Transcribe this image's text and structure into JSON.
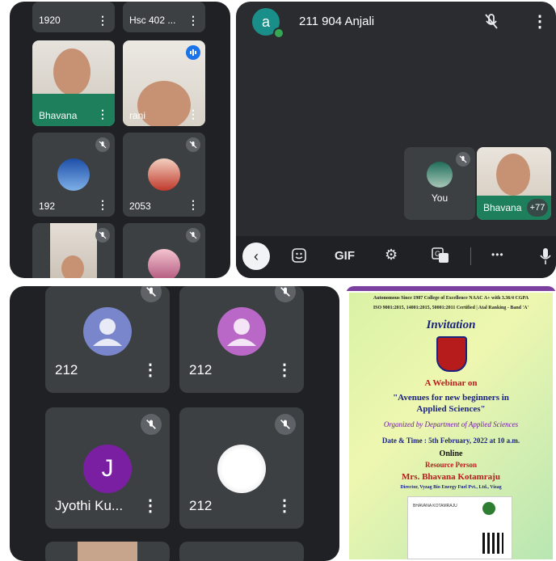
{
  "panel1": {
    "tiles": [
      {
        "name": "1920"
      },
      {
        "name": "Hsc 402 ..."
      },
      {
        "name": "Bhavana"
      },
      {
        "name": "rani"
      },
      {
        "name": "192"
      },
      {
        "name": "2053"
      }
    ]
  },
  "panel2": {
    "avatar_letter": "a",
    "title": "211 904 Anjali",
    "self_label": "You",
    "speaker_label": "Bhavana",
    "more_count": "+77",
    "toolbar": {
      "gif_label": "GIF",
      "more_label": "•••"
    }
  },
  "panel3": {
    "tiles": [
      {
        "name": "212"
      },
      {
        "name": "212"
      },
      {
        "name": "Jyothi Ku...",
        "initial": "J"
      },
      {
        "name": "212"
      }
    ]
  },
  "poster": {
    "header1": "Autonomous Since 1987   College of Excellence   NAAC A+ with 3.36/4 CGPA",
    "header2": "ISO 9001:2015, 14001:2015, 50001:2011 Certified | Atal Ranking - Band 'A'",
    "invitation": "Invitation",
    "webinar": "A Webinar on",
    "topic1": "\"Avenues for new beginners in",
    "topic2": "Applied Sciences\"",
    "organized": "Organized by Department of Applied Sciences",
    "date": "Date & Time : 5th February, 2022 at 10 a.m.",
    "online": "Online",
    "resource": "Resource Person",
    "person": "Mrs. Bhavana Kotamraju",
    "designation": "Director, Vyzag Bio Energy Fuel Pvt., Ltd., Vizag",
    "card_name": "BHAVANA KOTAMRAJU"
  },
  "colors": {
    "panel_bg": "#202124",
    "tile_bg": "#3c4043",
    "accent_teal": "#1a8f8a",
    "mic_badge": "#5f6368"
  }
}
